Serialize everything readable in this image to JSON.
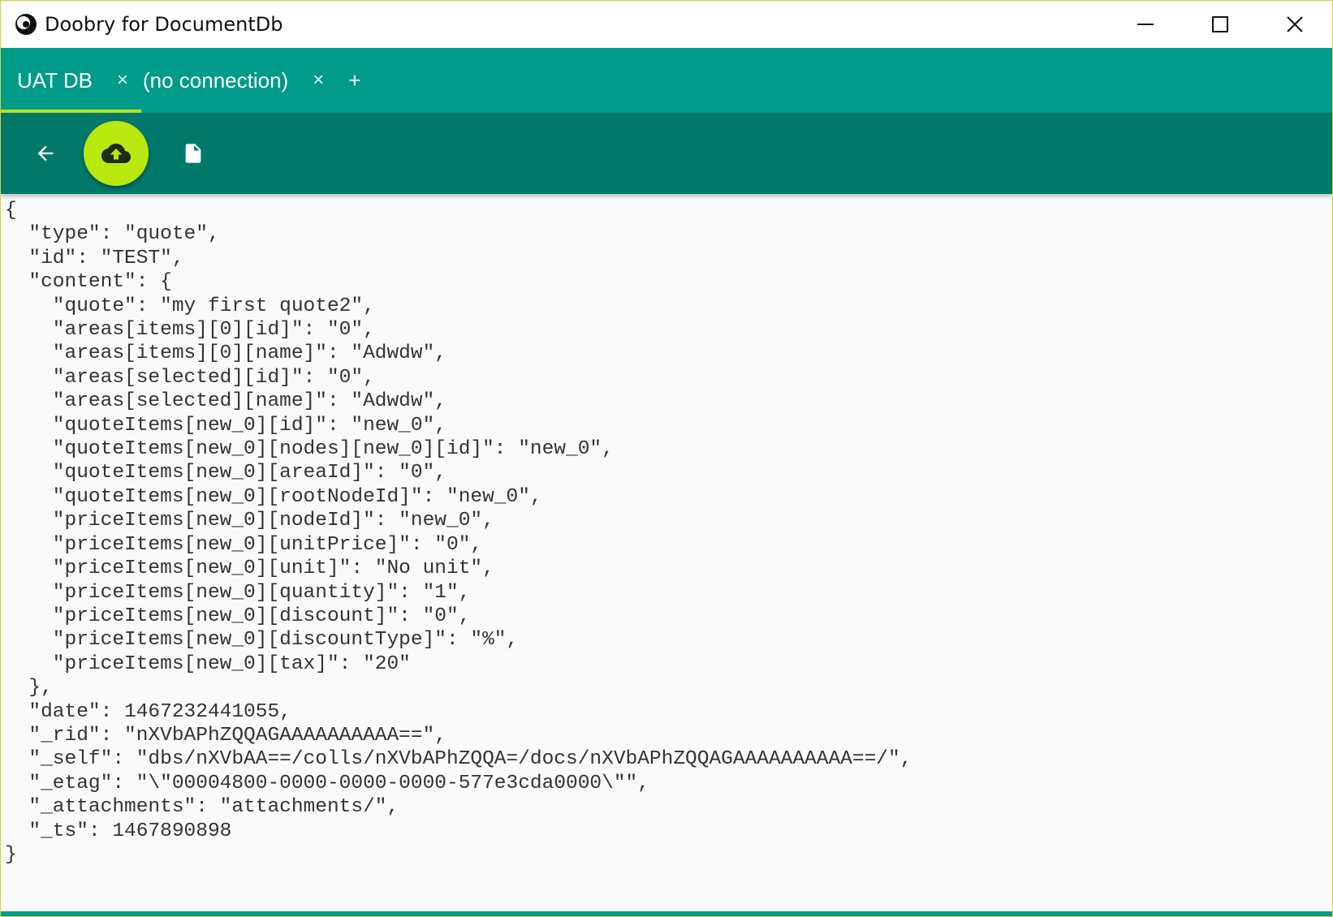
{
  "window": {
    "title": "Doobry for DocumentDb",
    "icon": "doobry-logo-icon",
    "controls": [
      "minimize-icon",
      "maximize-icon",
      "close-icon"
    ]
  },
  "tabs": [
    {
      "label": "UAT DB",
      "close": "×",
      "active": true
    },
    {
      "label": "(no connection)",
      "close": "×",
      "active": false
    }
  ],
  "tab_add_label": "+",
  "toolbar": {
    "back_icon": "arrow-left-icon",
    "save_icon": "cloud-upload-icon",
    "new_icon": "document-icon"
  },
  "colors": {
    "tabbar": "#009b89",
    "toolbar": "#00796b",
    "accent": "#b9e80f",
    "tab_indicator": "#b7e321"
  },
  "document_text": "{\n  \"type\": \"quote\",\n  \"id\": \"TEST\",\n  \"content\": {\n    \"quote\": \"my first quote2\",\n    \"areas[items][0][id]\": \"0\",\n    \"areas[items][0][name]\": \"Adwdw\",\n    \"areas[selected][id]\": \"0\",\n    \"areas[selected][name]\": \"Adwdw\",\n    \"quoteItems[new_0][id]\": \"new_0\",\n    \"quoteItems[new_0][nodes][new_0][id]\": \"new_0\",\n    \"quoteItems[new_0][areaId]\": \"0\",\n    \"quoteItems[new_0][rootNodeId]\": \"new_0\",\n    \"priceItems[new_0][nodeId]\": \"new_0\",\n    \"priceItems[new_0][unitPrice]\": \"0\",\n    \"priceItems[new_0][unit]\": \"No unit\",\n    \"priceItems[new_0][quantity]\": \"1\",\n    \"priceItems[new_0][discount]\": \"0\",\n    \"priceItems[new_0][discountType]\": \"%\",\n    \"priceItems[new_0][tax]\": \"20\"\n  },\n  \"date\": 1467232441055,\n  \"_rid\": \"nXVbAPhZQQAGAAAAAAAAAA==\",\n  \"_self\": \"dbs/nXVbAA==/colls/nXVbAPhZQQA=/docs/nXVbAPhZQQAGAAAAAAAAAA==/\",\n  \"_etag\": \"\\\"00004800-0000-0000-0000-577e3cda0000\\\"\",\n  \"_attachments\": \"attachments/\",\n  \"_ts\": 1467890898\n}"
}
